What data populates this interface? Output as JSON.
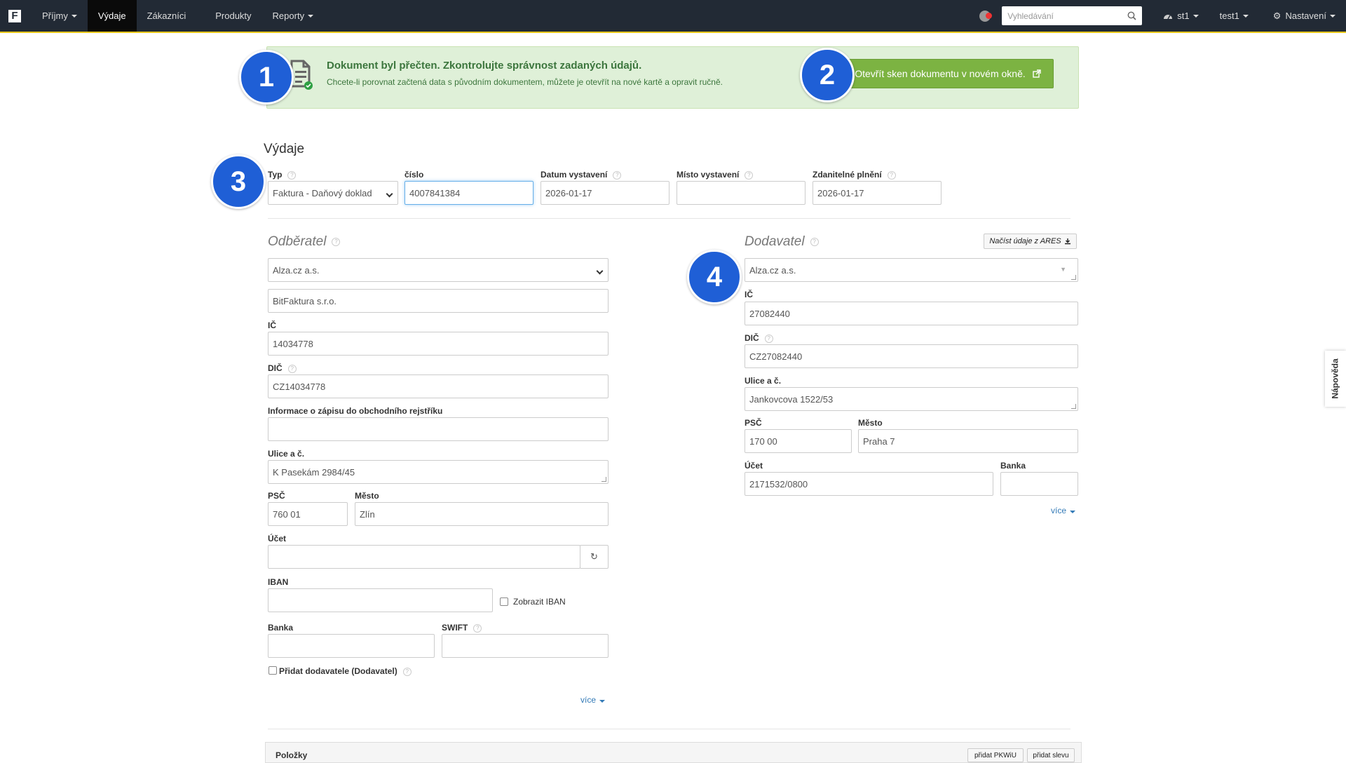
{
  "nav": {
    "logo": "F",
    "items": [
      {
        "label": "Příjmy"
      },
      {
        "label": "Výdaje"
      },
      {
        "label": "Zákazníci"
      },
      {
        "label": "Produkty"
      },
      {
        "label": "Reporty"
      }
    ],
    "search_placeholder": "Vyhledávání",
    "user1": "st1",
    "user2": "test1",
    "settings": "Nastavení"
  },
  "banner": {
    "title": "Dokument byl přečten. Zkontrolujte správnost zadaných údajů.",
    "subtitle": "Chcete-li porovnat začtená data s původním dokumentem, můžete je otevřít na nové kartě a opravit ručně.",
    "open_button": "Otevřít sken dokumentu v novém okně."
  },
  "badges": [
    "1",
    "2",
    "3",
    "4"
  ],
  "page_title": "Výdaje",
  "header_fields": {
    "typ_label": "Typ",
    "typ_value": "Faktura - Daňový doklad",
    "cislo_label": "číslo",
    "cislo_value": "4007841384",
    "datum_label": "Datum vystavení",
    "datum_value": "2026-01-17",
    "misto_label": "Místo vystavení",
    "misto_value": "",
    "zdanitelne_label": "Zdanitelné plnění",
    "zdanitelne_value": "2026-01-17"
  },
  "odberatel": {
    "title": "Odběratel",
    "select_value": "Alza.cz a.s.",
    "name_value": "BitFaktura s.r.o.",
    "ic_label": "IČ",
    "ic_value": "14034778",
    "dic_label": "DIČ",
    "dic_value": "CZ14034778",
    "rejstrik_label": "Informace o zápisu do obchodního rejstříku",
    "rejstrik_value": "",
    "ulice_label": "Ulice a č.",
    "ulice_value": "K Pasekám 2984/45",
    "psc_label": "PSČ",
    "psc_value": "760 01",
    "mesto_label": "Město",
    "mesto_value": "Zlín",
    "ucet_label": "Účet",
    "ucet_value": "",
    "refresh_icon": "↻",
    "iban_label": "IBAN",
    "iban_value": "",
    "show_iban_label": "Zobrazit IBAN",
    "banka_label": "Banka",
    "banka_value": "",
    "swift_label": "SWIFT",
    "swift_value": "",
    "pridat_label": "Přidat dodavatele (Dodavatel)",
    "more": "více"
  },
  "dodavatel": {
    "title": "Dodavatel",
    "ares_button": "Načíst údaje z ARES",
    "select_value": "Alza.cz a.s.",
    "ic_label": "IČ",
    "ic_value": "27082440",
    "dic_label": "DIČ",
    "dic_value": "CZ27082440",
    "ulice_label": "Ulice a č.",
    "ulice_value": "Jankovcova 1522/53",
    "psc_label": "PSČ",
    "psc_value": "170 00",
    "mesto_label": "Město",
    "mesto_value": "Praha 7",
    "ucet_label": "Účet",
    "ucet_value": "2171532/0800",
    "banka_label": "Banka",
    "banka_value": "",
    "more": "více"
  },
  "side_tab": "Nápověda",
  "items": {
    "title": "Položky",
    "add_pkwiu": "přidat PKWiU",
    "add_discount": "přidat slevu"
  },
  "colors": {
    "navbar": "#222a35",
    "accent_line": "#e6c619",
    "badge": "#1f5fd6",
    "banner_bg": "#dff0d8",
    "open_button": "#7cb342"
  }
}
